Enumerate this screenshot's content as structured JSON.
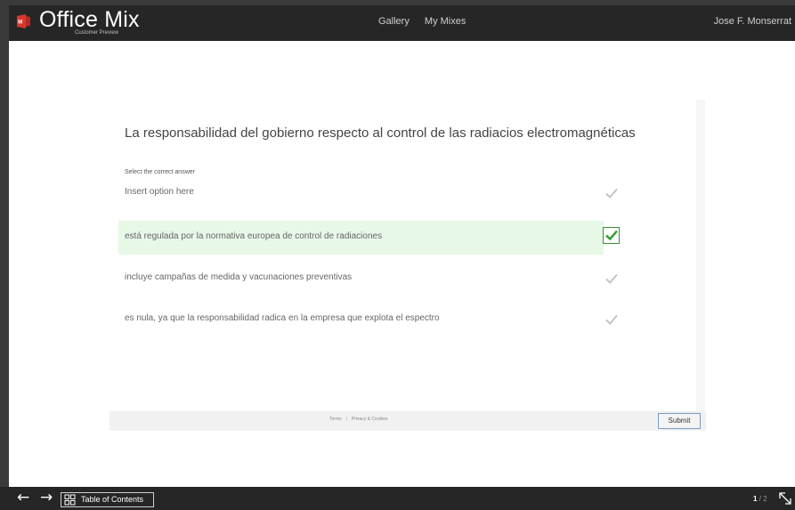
{
  "header": {
    "brand": "Office Mix",
    "brand_subtitle": "Customer Preview",
    "nav": [
      "Gallery",
      "My Mixes"
    ],
    "user_name": "Jose F. Monserrat"
  },
  "quiz": {
    "question": "La responsabilidad del gobierno respecto al control de las radiacios electromagnéticas",
    "prompt": "Select the correct answer",
    "options": [
      {
        "text": "Insert option here",
        "selected": false
      },
      {
        "text": "está regulada por la normativa europea de control de radiaciones",
        "selected": true
      },
      {
        "text": "incluye campañas de medida y vacunaciones preventivas",
        "selected": false
      },
      {
        "text": "es nula, ya que la responsabilidad radica en la empresa que explota el espectro",
        "selected": false
      }
    ]
  },
  "footer": {
    "terms": "Terms",
    "privacy": "Privacy & Cookies",
    "submit_label": "Submit"
  },
  "player": {
    "toc_label": "Table of Contents",
    "current_page": "1",
    "total_pages": "/ 2"
  },
  "colors": {
    "selected_bg": "#e7f8e7",
    "check_green": "#2e9b2e",
    "check_gray": "#c4c4c4",
    "bar_dark": "#262626",
    "logo_red": "#d9372c"
  },
  "icons": {
    "logo": "office-mix-logo-icon",
    "check": "check-icon",
    "back": "arrow-left-icon",
    "forward": "arrow-right-icon",
    "toc": "grid-icon",
    "expand": "expand-icon"
  }
}
